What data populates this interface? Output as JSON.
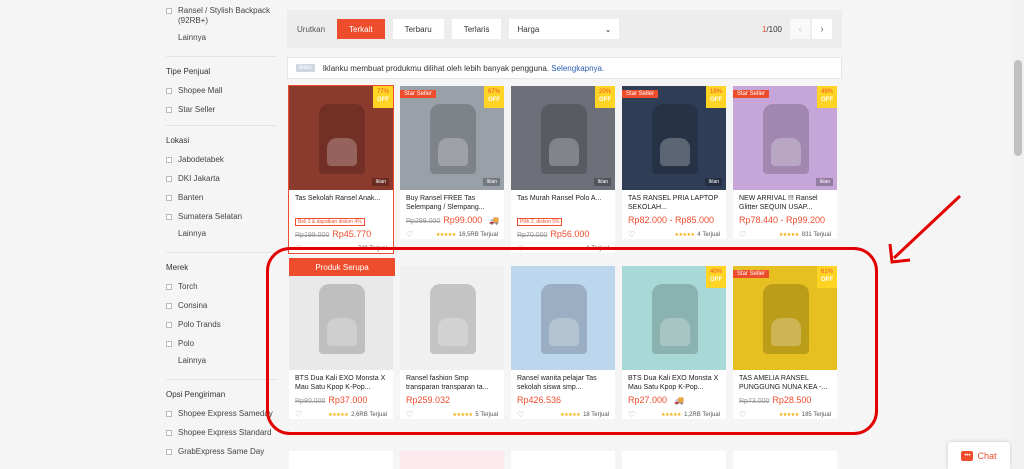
{
  "sidebar": {
    "top_items": [
      {
        "label": "Ransel / Stylish Backpack (92RB+)"
      }
    ],
    "top_more": "Lainnya",
    "seller_type": {
      "title": "Tipe Penjual",
      "items": [
        {
          "label": "Shopee Mall"
        },
        {
          "label": "Star Seller"
        }
      ]
    },
    "location": {
      "title": "Lokasi",
      "items": [
        {
          "label": "Jabodetabek"
        },
        {
          "label": "DKI Jakarta"
        },
        {
          "label": "Banten"
        },
        {
          "label": "Sumatera Selatan"
        }
      ],
      "more": "Lainnya"
    },
    "brand": {
      "title": "Merek",
      "items": [
        {
          "label": "Torch"
        },
        {
          "label": "Consina"
        },
        {
          "label": "Polo Trands"
        },
        {
          "label": "Polo"
        }
      ],
      "more": "Lainnya"
    },
    "shipping": {
      "title": "Opsi Pengiriman",
      "items": [
        {
          "label": "Shopee Express Sameday"
        },
        {
          "label": "Shopee Express Standard"
        },
        {
          "label": "GrabExpress Same Day"
        }
      ]
    }
  },
  "sortbar": {
    "label": "Urutkan",
    "options": [
      {
        "label": "Terkait"
      },
      {
        "label": "Terbaru"
      },
      {
        "label": "Terlaris"
      }
    ],
    "price_select": "Harga",
    "page_current": "1",
    "page_total": "/100"
  },
  "ad_notice": {
    "tag": "Iklan",
    "text": "Iklanku membuat produkmu dilihat oleh lebih banyak pengguna.",
    "link": "Selengkapnya."
  },
  "similar_button": "Produk Serupa",
  "products": [
    {
      "name": "Tas Sekolah Ransel Anak...",
      "promo": "Beli 3 & dapatkan diskon 4%",
      "orig": "Rp199.000",
      "price": "Rp45.770",
      "sold": "740 Terjual",
      "discount": "77%",
      "off": "OFF",
      "star_seller": "",
      "iklan": "Iklan"
    },
    {
      "name": "Buy Ransel FREE Tas Selempang / Slempang...",
      "promo": "",
      "orig": "Rp299.000",
      "price": "Rp99.000",
      "sold": "16,5RB Terjual",
      "discount": "67%",
      "off": "OFF",
      "star_seller": "Star Seller",
      "iklan": "Iklan"
    },
    {
      "name": "Tas Murah Ransel Polo A...",
      "promo": "Pilih 2, diskon 5%",
      "orig": "Rp70.000",
      "price": "Rp56.000",
      "sold": "1 Terjual",
      "discount": "20%",
      "off": "OFF",
      "star_seller": "",
      "iklan": "Iklan"
    },
    {
      "name": "TAS RANSEL PRIA LAPTOP SEKOLAH...",
      "promo": "",
      "orig": "",
      "price": "Rp82.000 - Rp85.000",
      "sold": "4 Terjual",
      "discount": "18%",
      "off": "OFF",
      "star_seller": "Star Seller",
      "iklan": "Iklan"
    },
    {
      "name": "NEW ARRIVAL !!! Ransel Glitter SEQUIN USAP...",
      "promo": "",
      "orig": "",
      "price": "Rp78.440 - Rp99.200",
      "sold": "831 Terjual",
      "discount": "49%",
      "off": "OFF",
      "star_seller": "Star Seller",
      "iklan": "Iklan"
    },
    {
      "name": "BTS Dua Kali EXO Monsta X Mau Satu Kpop K-Pop...",
      "promo": "",
      "orig": "Rp80.000",
      "price": "Rp37.000",
      "sold": "2,6RB Terjual",
      "discount": "",
      "off": "",
      "star_seller": "",
      "iklan": ""
    },
    {
      "name": "Ransel fashion Smp transparan transparan ta...",
      "promo": "",
      "orig": "",
      "price": "Rp259.032",
      "sold": "5 Terjual",
      "discount": "",
      "off": "",
      "star_seller": "",
      "iklan": ""
    },
    {
      "name": "Ransel wanita pelajar Tas sekolah siswa smp...",
      "promo": "",
      "orig": "",
      "price": "Rp426.536",
      "sold": "18 Terjual",
      "discount": "",
      "off": "",
      "star_seller": "",
      "iklan": ""
    },
    {
      "name": "BTS Dua Kali EXO Monsta X Mau Satu Kpop K-Pop...",
      "promo": "",
      "orig": "",
      "price": "Rp27.000",
      "sold": "1,2RB Terjual",
      "discount": "40%",
      "off": "OFF",
      "star_seller": "",
      "iklan": ""
    },
    {
      "name": "TAS AMELIA RANSEL PUNGGUNG NUNA KEA -...",
      "promo": "",
      "orig": "Rp73.000",
      "price": "Rp28.500",
      "sold": "185 Terjual",
      "discount": "61%",
      "off": "OFF",
      "star_seller": "Star Seller",
      "iklan": ""
    }
  ],
  "chat": {
    "label": "Chat"
  },
  "colors": {
    "accent": "#ee4d2d",
    "annotation": "#e30000"
  }
}
